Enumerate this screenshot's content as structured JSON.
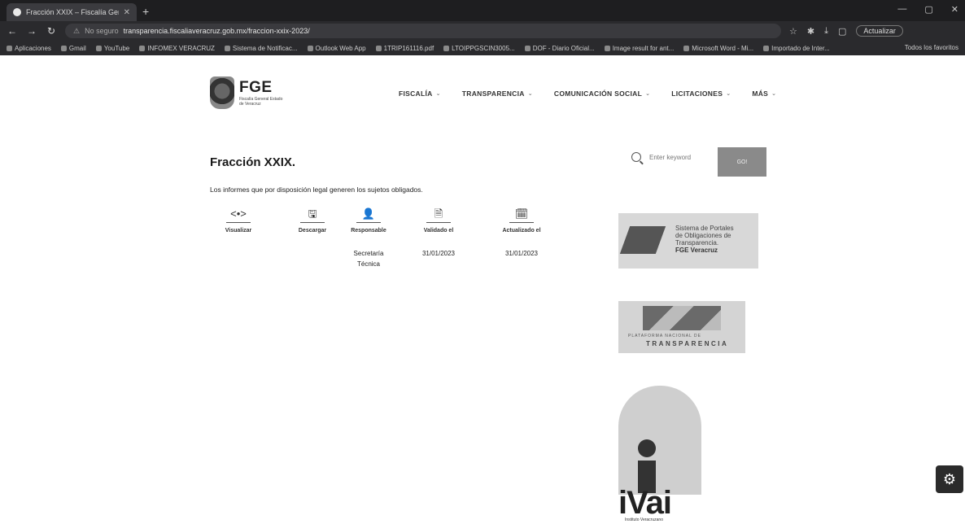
{
  "browser": {
    "tab_title": "Fracción XXIX – Fiscalía General",
    "tab_close": "✕",
    "new_tab": "+",
    "window_controls": [
      "—",
      "▢",
      "✕"
    ],
    "security_label": "No seguro",
    "url": "transparencia.fiscaliaveracruz.gob.mx/fraccion-xxix-2023/",
    "update_button": "Actualizar",
    "bookmarks": [
      "Aplicaciones",
      "Gmail",
      "YouTube",
      "INFOMEX VERACRUZ",
      "Sistema de Notificac...",
      "Outlook Web App",
      "1TRIP161116.pdf",
      "LTOIPPGSCIN3005...",
      "DOF - Diario Oficial...",
      "Image result for ant...",
      "Microsoft Word - Mi...",
      "Importado de Inter..."
    ],
    "bookmarks_right": "Todos los favoritos"
  },
  "site": {
    "logo_text": "FGE",
    "logo_subtitle": "Fiscalía General Estado de Veracruz",
    "menu": [
      {
        "label": "FISCALÍA",
        "chevron": "⌄"
      },
      {
        "label": "TRANSPARENCIA",
        "chevron": "⌄"
      },
      {
        "label": "COMUNICACIÓN SOCIAL",
        "chevron": "⌄"
      },
      {
        "label": "LICITACIONES",
        "chevron": "⌄"
      },
      {
        "label": "MÁS",
        "chevron": "⌄"
      }
    ]
  },
  "main": {
    "title": "Fracción XXIX.",
    "description": "Los informes que por disposición legal generen los sujetos obligados.",
    "meta": [
      {
        "icon": "eye-code-icon",
        "glyph": "<•>",
        "label": "Visualizar",
        "value": ""
      },
      {
        "icon": "save-icon",
        "glyph": "🖫",
        "label": "Descargar",
        "value": ""
      },
      {
        "icon": "person-icon",
        "glyph": "👤",
        "label": "Responsable",
        "value": "Secretaría Técnica"
      },
      {
        "icon": "validated-icon",
        "glyph": "🗎",
        "label": "Validado el",
        "value": "31/01/2023"
      },
      {
        "icon": "calendar-icon",
        "glyph": "🗓",
        "label": "Actualizado el",
        "value": "31/01/2023"
      }
    ]
  },
  "sidebar": {
    "search_placeholder": "Enter keyword",
    "go_label": "GO!",
    "banner1": {
      "line1": "Sistema de Portales",
      "line2": "de Obligaciones de",
      "line3": "Transparencia.",
      "line4": "FGE Veracruz"
    },
    "banner2": {
      "sub": "PLATAFORMA NACIONAL DE",
      "main": "TRANSPARENCIA"
    },
    "ivai": {
      "word": "iVai",
      "caption": "Instituto Veracruzano"
    }
  },
  "a11y_glyph": "⚙"
}
